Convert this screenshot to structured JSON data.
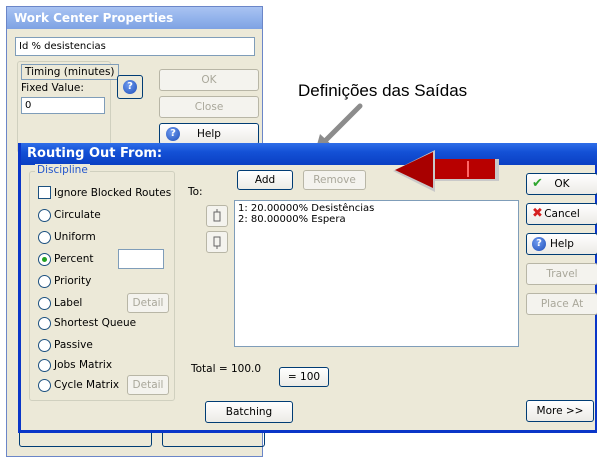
{
  "work_center": {
    "title": "Work Center Properties",
    "name_value": "Id % desistencias",
    "timing_label": "Timing (minutes)",
    "fixed_value_label": "Fixed Value:",
    "fixed_value": "0",
    "ok_label": "OK",
    "close_label": "Close",
    "help_label": "Help"
  },
  "annotation": "Definições das Saídas",
  "routing": {
    "title": "Routing Out From:",
    "discipline_label": "Discipline",
    "ignore_blocked_label": "Ignore Blocked Routes",
    "options": [
      "Circulate",
      "Uniform",
      "Percent",
      "Priority",
      "Label",
      "Shortest Queue",
      "Passive",
      "Jobs Matrix",
      "Cycle Matrix"
    ],
    "selected_option": "Percent",
    "detail_label": "Detail",
    "to_label": "To:",
    "add_label": "Add",
    "remove_label": "Remove",
    "routes": [
      "1: 20.00000% Desistências",
      "2: 80.00000% Espera"
    ],
    "total_label": "Total = 100.0",
    "eq100_label": "= 100",
    "batching_label": "Batching",
    "ok_label": "OK",
    "cancel_label": "Cancel",
    "help_label": "Help",
    "travel_label": "Travel",
    "place_at_label": "Place At",
    "more_label": "More >>"
  },
  "colors": {
    "title_blue": "#0a3fc3",
    "arrow_red": "#b00000",
    "face": "#ece9d8"
  }
}
